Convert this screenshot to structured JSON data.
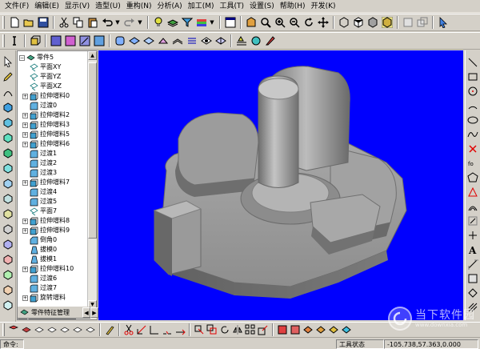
{
  "menubar": {
    "items": [
      {
        "label": "文件(F)"
      },
      {
        "label": "编辑(E)"
      },
      {
        "label": "显示(V)"
      },
      {
        "label": "造型(U)"
      },
      {
        "label": "重构(N)"
      },
      {
        "label": "分析(A)"
      },
      {
        "label": "加工(M)"
      },
      {
        "label": "工具(T)"
      },
      {
        "label": "设置(S)"
      },
      {
        "label": "帮助(H)"
      },
      {
        "label": "开发(K)"
      }
    ]
  },
  "feature_tree": {
    "root": "零件5",
    "nodes": [
      {
        "label": "平面XY",
        "kind": "plane",
        "expandable": false
      },
      {
        "label": "平面YZ",
        "kind": "plane",
        "expandable": false
      },
      {
        "label": "平面XZ",
        "kind": "plane",
        "expandable": false
      },
      {
        "label": "拉伸增料0",
        "kind": "extrude",
        "expandable": true
      },
      {
        "label": "过渡0",
        "kind": "fillet",
        "expandable": false
      },
      {
        "label": "拉伸增料2",
        "kind": "extrude",
        "expandable": true
      },
      {
        "label": "拉伸增料3",
        "kind": "extrude",
        "expandable": true
      },
      {
        "label": "拉伸增料5",
        "kind": "extrude",
        "expandable": true
      },
      {
        "label": "拉伸增料6",
        "kind": "extrude",
        "expandable": true
      },
      {
        "label": "过渡1",
        "kind": "fillet",
        "expandable": false
      },
      {
        "label": "过渡2",
        "kind": "fillet",
        "expandable": false
      },
      {
        "label": "过渡3",
        "kind": "fillet",
        "expandable": false
      },
      {
        "label": "拉伸增料7",
        "kind": "extrude",
        "expandable": true
      },
      {
        "label": "过渡4",
        "kind": "fillet",
        "expandable": false
      },
      {
        "label": "过渡5",
        "kind": "fillet",
        "expandable": false
      },
      {
        "label": "平面7",
        "kind": "plane",
        "expandable": false
      },
      {
        "label": "拉伸增料8",
        "kind": "extrude",
        "expandable": true
      },
      {
        "label": "拉伸增料9",
        "kind": "extrude",
        "expandable": true
      },
      {
        "label": "倒角0",
        "kind": "chamfer",
        "expandable": false
      },
      {
        "label": "拔模0",
        "kind": "draft",
        "expandable": false
      },
      {
        "label": "拔模1",
        "kind": "draft",
        "expandable": false
      },
      {
        "label": "拉伸增料10",
        "kind": "extrude",
        "expandable": true
      },
      {
        "label": "过渡6",
        "kind": "fillet",
        "expandable": false
      },
      {
        "label": "过渡7",
        "kind": "fillet",
        "expandable": false
      },
      {
        "label": "旋转增料",
        "kind": "extrude",
        "expandable": true
      }
    ],
    "tab_label": "零件特征管理"
  },
  "statusbar": {
    "left": "命令:",
    "mode": "工具状态",
    "coords": "-105.738,57.363,0.000"
  },
  "watermark": {
    "title": "当下软件园",
    "url": "www.downxia.com"
  },
  "colors": {
    "viewport_bg": "#0000fe",
    "chrome": "#d4d0c8",
    "model_shade": "#9a9a9a"
  }
}
